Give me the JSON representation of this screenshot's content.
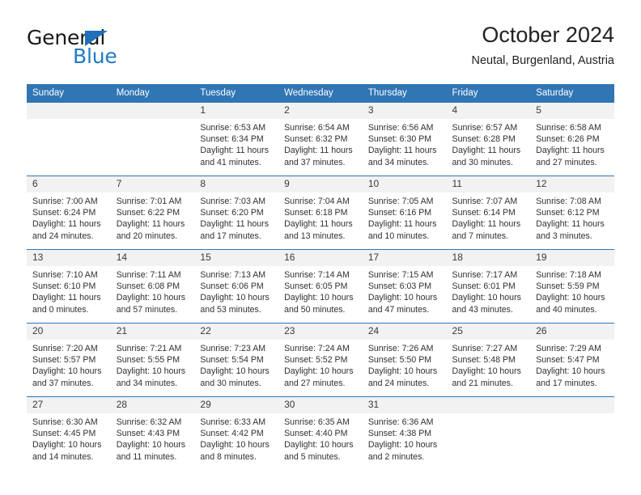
{
  "brand": {
    "name_top": "General",
    "name_bottom": "Blue",
    "triangle_color": "#1f70b8",
    "blue_color": "#1f7ac8"
  },
  "header": {
    "title": "October 2024",
    "subtitle": "Neutal, Burgenland, Austria"
  },
  "theme": {
    "header_blue": "#3075b4",
    "daynum_band": "#f2f2f2",
    "text": "#303030"
  },
  "weekday_headers": [
    "Sunday",
    "Monday",
    "Tuesday",
    "Wednesday",
    "Thursday",
    "Friday",
    "Saturday"
  ],
  "labels": {
    "sunrise_prefix": "Sunrise:",
    "sunset_prefix": "Sunset:",
    "daylight_prefix": "Daylight:"
  },
  "weeks": [
    [
      {
        "day": "",
        "sunrise": "",
        "sunset": "",
        "daylight_line1": "",
        "daylight_line2": ""
      },
      {
        "day": "",
        "sunrise": "",
        "sunset": "",
        "daylight_line1": "",
        "daylight_line2": ""
      },
      {
        "day": "1",
        "sunrise": "Sunrise: 6:53 AM",
        "sunset": "Sunset: 6:34 PM",
        "daylight_line1": "Daylight: 11 hours",
        "daylight_line2": "and 41 minutes."
      },
      {
        "day": "2",
        "sunrise": "Sunrise: 6:54 AM",
        "sunset": "Sunset: 6:32 PM",
        "daylight_line1": "Daylight: 11 hours",
        "daylight_line2": "and 37 minutes."
      },
      {
        "day": "3",
        "sunrise": "Sunrise: 6:56 AM",
        "sunset": "Sunset: 6:30 PM",
        "daylight_line1": "Daylight: 11 hours",
        "daylight_line2": "and 34 minutes."
      },
      {
        "day": "4",
        "sunrise": "Sunrise: 6:57 AM",
        "sunset": "Sunset: 6:28 PM",
        "daylight_line1": "Daylight: 11 hours",
        "daylight_line2": "and 30 minutes."
      },
      {
        "day": "5",
        "sunrise": "Sunrise: 6:58 AM",
        "sunset": "Sunset: 6:26 PM",
        "daylight_line1": "Daylight: 11 hours",
        "daylight_line2": "and 27 minutes."
      }
    ],
    [
      {
        "day": "6",
        "sunrise": "Sunrise: 7:00 AM",
        "sunset": "Sunset: 6:24 PM",
        "daylight_line1": "Daylight: 11 hours",
        "daylight_line2": "and 24 minutes."
      },
      {
        "day": "7",
        "sunrise": "Sunrise: 7:01 AM",
        "sunset": "Sunset: 6:22 PM",
        "daylight_line1": "Daylight: 11 hours",
        "daylight_line2": "and 20 minutes."
      },
      {
        "day": "8",
        "sunrise": "Sunrise: 7:03 AM",
        "sunset": "Sunset: 6:20 PM",
        "daylight_line1": "Daylight: 11 hours",
        "daylight_line2": "and 17 minutes."
      },
      {
        "day": "9",
        "sunrise": "Sunrise: 7:04 AM",
        "sunset": "Sunset: 6:18 PM",
        "daylight_line1": "Daylight: 11 hours",
        "daylight_line2": "and 13 minutes."
      },
      {
        "day": "10",
        "sunrise": "Sunrise: 7:05 AM",
        "sunset": "Sunset: 6:16 PM",
        "daylight_line1": "Daylight: 11 hours",
        "daylight_line2": "and 10 minutes."
      },
      {
        "day": "11",
        "sunrise": "Sunrise: 7:07 AM",
        "sunset": "Sunset: 6:14 PM",
        "daylight_line1": "Daylight: 11 hours",
        "daylight_line2": "and 7 minutes."
      },
      {
        "day": "12",
        "sunrise": "Sunrise: 7:08 AM",
        "sunset": "Sunset: 6:12 PM",
        "daylight_line1": "Daylight: 11 hours",
        "daylight_line2": "and 3 minutes."
      }
    ],
    [
      {
        "day": "13",
        "sunrise": "Sunrise: 7:10 AM",
        "sunset": "Sunset: 6:10 PM",
        "daylight_line1": "Daylight: 11 hours",
        "daylight_line2": "and 0 minutes."
      },
      {
        "day": "14",
        "sunrise": "Sunrise: 7:11 AM",
        "sunset": "Sunset: 6:08 PM",
        "daylight_line1": "Daylight: 10 hours",
        "daylight_line2": "and 57 minutes."
      },
      {
        "day": "15",
        "sunrise": "Sunrise: 7:13 AM",
        "sunset": "Sunset: 6:06 PM",
        "daylight_line1": "Daylight: 10 hours",
        "daylight_line2": "and 53 minutes."
      },
      {
        "day": "16",
        "sunrise": "Sunrise: 7:14 AM",
        "sunset": "Sunset: 6:05 PM",
        "daylight_line1": "Daylight: 10 hours",
        "daylight_line2": "and 50 minutes."
      },
      {
        "day": "17",
        "sunrise": "Sunrise: 7:15 AM",
        "sunset": "Sunset: 6:03 PM",
        "daylight_line1": "Daylight: 10 hours",
        "daylight_line2": "and 47 minutes."
      },
      {
        "day": "18",
        "sunrise": "Sunrise: 7:17 AM",
        "sunset": "Sunset: 6:01 PM",
        "daylight_line1": "Daylight: 10 hours",
        "daylight_line2": "and 43 minutes."
      },
      {
        "day": "19",
        "sunrise": "Sunrise: 7:18 AM",
        "sunset": "Sunset: 5:59 PM",
        "daylight_line1": "Daylight: 10 hours",
        "daylight_line2": "and 40 minutes."
      }
    ],
    [
      {
        "day": "20",
        "sunrise": "Sunrise: 7:20 AM",
        "sunset": "Sunset: 5:57 PM",
        "daylight_line1": "Daylight: 10 hours",
        "daylight_line2": "and 37 minutes."
      },
      {
        "day": "21",
        "sunrise": "Sunrise: 7:21 AM",
        "sunset": "Sunset: 5:55 PM",
        "daylight_line1": "Daylight: 10 hours",
        "daylight_line2": "and 34 minutes."
      },
      {
        "day": "22",
        "sunrise": "Sunrise: 7:23 AM",
        "sunset": "Sunset: 5:54 PM",
        "daylight_line1": "Daylight: 10 hours",
        "daylight_line2": "and 30 minutes."
      },
      {
        "day": "23",
        "sunrise": "Sunrise: 7:24 AM",
        "sunset": "Sunset: 5:52 PM",
        "daylight_line1": "Daylight: 10 hours",
        "daylight_line2": "and 27 minutes."
      },
      {
        "day": "24",
        "sunrise": "Sunrise: 7:26 AM",
        "sunset": "Sunset: 5:50 PM",
        "daylight_line1": "Daylight: 10 hours",
        "daylight_line2": "and 24 minutes."
      },
      {
        "day": "25",
        "sunrise": "Sunrise: 7:27 AM",
        "sunset": "Sunset: 5:48 PM",
        "daylight_line1": "Daylight: 10 hours",
        "daylight_line2": "and 21 minutes."
      },
      {
        "day": "26",
        "sunrise": "Sunrise: 7:29 AM",
        "sunset": "Sunset: 5:47 PM",
        "daylight_line1": "Daylight: 10 hours",
        "daylight_line2": "and 17 minutes."
      }
    ],
    [
      {
        "day": "27",
        "sunrise": "Sunrise: 6:30 AM",
        "sunset": "Sunset: 4:45 PM",
        "daylight_line1": "Daylight: 10 hours",
        "daylight_line2": "and 14 minutes."
      },
      {
        "day": "28",
        "sunrise": "Sunrise: 6:32 AM",
        "sunset": "Sunset: 4:43 PM",
        "daylight_line1": "Daylight: 10 hours",
        "daylight_line2": "and 11 minutes."
      },
      {
        "day": "29",
        "sunrise": "Sunrise: 6:33 AM",
        "sunset": "Sunset: 4:42 PM",
        "daylight_line1": "Daylight: 10 hours",
        "daylight_line2": "and 8 minutes."
      },
      {
        "day": "30",
        "sunrise": "Sunrise: 6:35 AM",
        "sunset": "Sunset: 4:40 PM",
        "daylight_line1": "Daylight: 10 hours",
        "daylight_line2": "and 5 minutes."
      },
      {
        "day": "31",
        "sunrise": "Sunrise: 6:36 AM",
        "sunset": "Sunset: 4:38 PM",
        "daylight_line1": "Daylight: 10 hours",
        "daylight_line2": "and 2 minutes."
      },
      {
        "day": "",
        "sunrise": "",
        "sunset": "",
        "daylight_line1": "",
        "daylight_line2": ""
      },
      {
        "day": "",
        "sunrise": "",
        "sunset": "",
        "daylight_line1": "",
        "daylight_line2": ""
      }
    ]
  ]
}
